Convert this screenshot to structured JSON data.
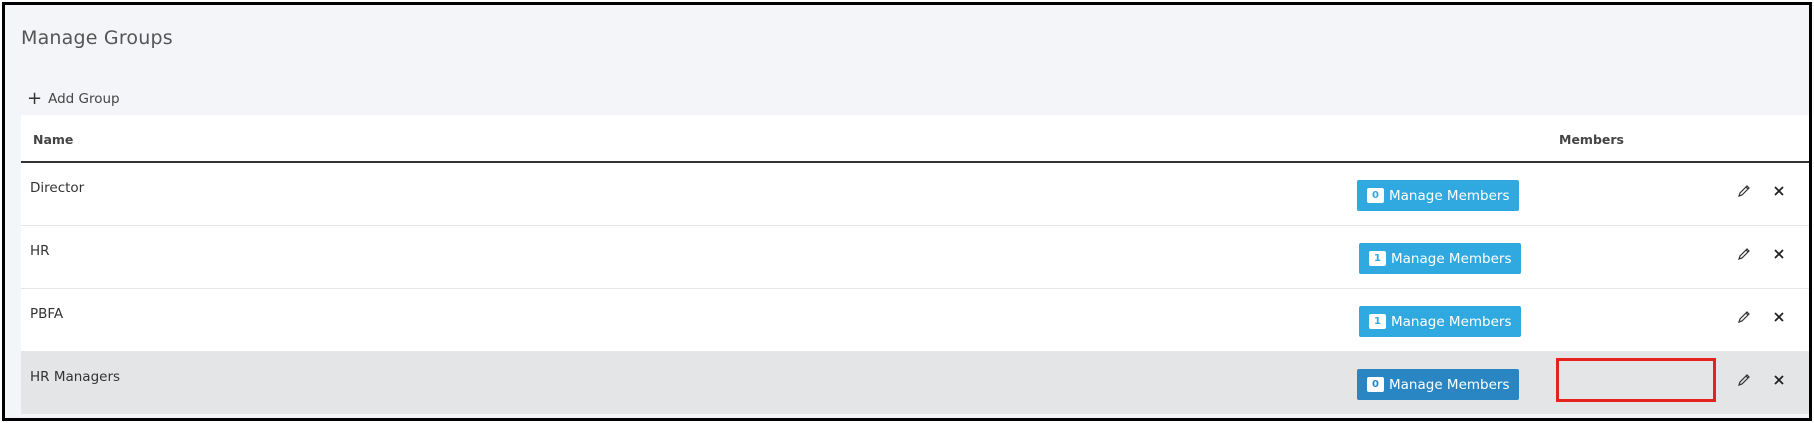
{
  "page": {
    "title": "Manage Groups"
  },
  "toolbar": {
    "add_group_label": "Add Group",
    "add_icon": "plus-icon"
  },
  "table": {
    "headers": {
      "name": "Name",
      "members": "Members"
    },
    "rows": [
      {
        "name": "Director",
        "member_count": "0",
        "button_label": "Manage Members",
        "highlighted": false
      },
      {
        "name": "HR",
        "member_count": "1",
        "button_label": "Manage Members",
        "highlighted": false
      },
      {
        "name": "PBFA",
        "member_count": "1",
        "button_label": "Manage Members",
        "highlighted": false
      },
      {
        "name": "HR Managers",
        "member_count": "0",
        "button_label": "Manage Members",
        "highlighted": true
      }
    ]
  },
  "icons": {
    "edit": "pencil-icon",
    "delete": "close-icon"
  },
  "colors": {
    "button": "#2fa9e0",
    "button_active": "#2a86c3",
    "highlight_box": "#e3231f",
    "selected_row": "#e4e5e7"
  }
}
